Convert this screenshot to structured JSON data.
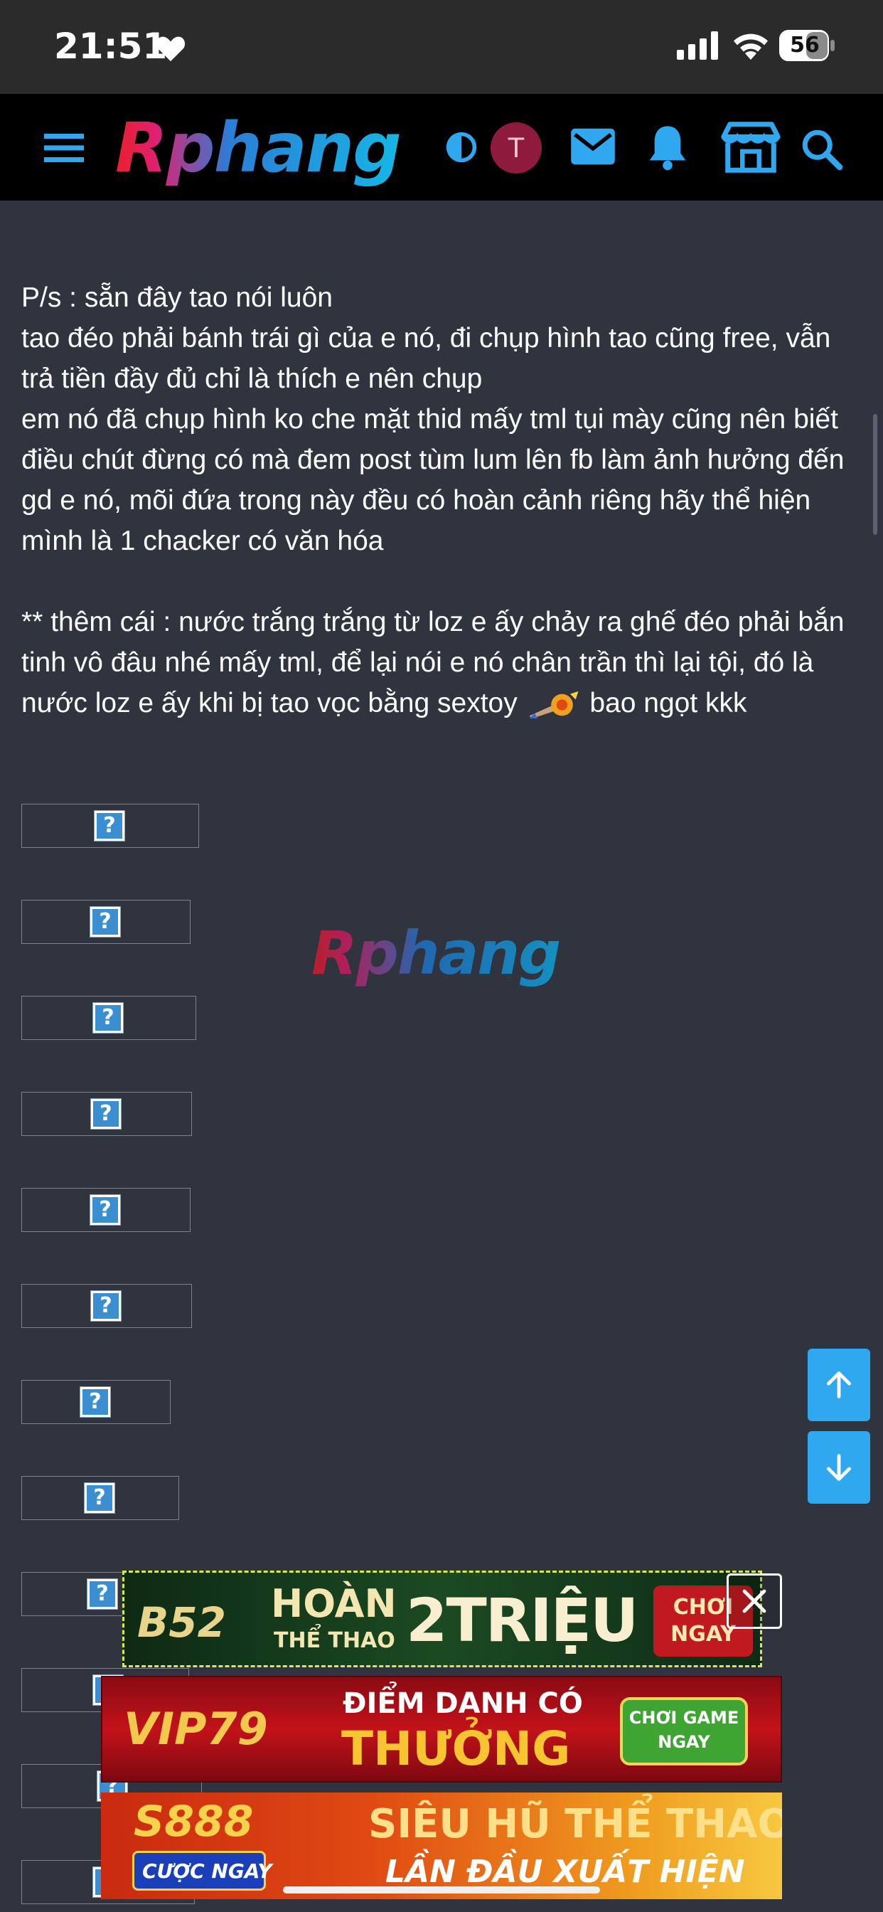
{
  "status_bar": {
    "time": "21:51",
    "battery": "56"
  },
  "nav": {
    "logo": "Rphang",
    "avatar_letter": "T",
    "icons": [
      "menu-icon",
      "theme-toggle-icon",
      "mail-icon",
      "bell-icon",
      "store-icon",
      "search-icon"
    ]
  },
  "post": {
    "paragraphs": [
      "P/s : sẵn đây tao nói luôn\ntao đéo phải bánh trái gì của e nó, đi chụp hình tao cũng free, vẫn trả tiền đầy đủ chỉ là thích e nên chụp\nem nó đã chụp hình ko che mặt thid mấy tml tụi mày cũng nên biết điều chút đừng có mà đem post tùm lum lên fb làm ảnh hưởng đến gd e nó, mõi đứa trong này đều có hoàn cảnh riêng hãy thể hiện mình là 1 chacker có văn hóa"
    ],
    "note_before_emoji": "** thêm cái : nước trắng trắng từ loz e ấy chảy ra ghế đéo phải bắn tinh vô đâu nhé mấy tml, để lại nói e nó chân trần thì lại tội, đó là nước loz e ấy khi bị tao vọc bằng sextoy ",
    "note_after_emoji": " bao ngọt kkk",
    "broken_image_glyph": "?"
  },
  "watermark": "Rphang",
  "ads": {
    "b52": {
      "brand": "B52",
      "line1": "HOÀN",
      "line2": "THỂ THAO",
      "amount": "2TRIỆU",
      "cta": "CHƠI NGAY"
    },
    "vip79": {
      "brand": "VIP79",
      "line1": "ĐIỂM DANH CÓ",
      "line2": "THƯỞNG",
      "cta": "CHƠI GAME NGAY"
    },
    "s888": {
      "brand": "S888",
      "cta": "CƯỢC NGAY",
      "line1": "SIÊU HŨ THỂ THAO",
      "line2": "LẦN ĐẦU XUẤT HIỆN"
    }
  },
  "colors": {
    "page_bg": "#30343f",
    "navbar_bg": "#000000",
    "accent": "#2fa8f0",
    "avatar_bg": "#8e1b3d"
  }
}
